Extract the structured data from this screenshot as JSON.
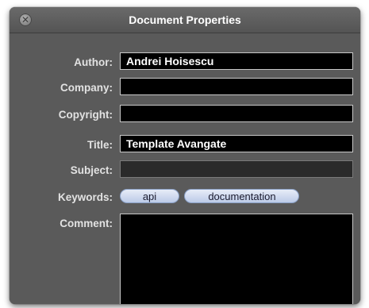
{
  "window": {
    "title": "Document Properties",
    "close_icon": "close-icon",
    "close_glyph": "✕"
  },
  "fields": {
    "author": {
      "label": "Author:",
      "value": "Andrei Hoisescu"
    },
    "company": {
      "label": "Company:",
      "value": ""
    },
    "copyright": {
      "label": "Copyright:",
      "value": ""
    },
    "title": {
      "label": "Title:",
      "value": "Template Avangate"
    },
    "subject": {
      "label": "Subject:",
      "value": ""
    },
    "keywords": {
      "label": "Keywords:",
      "tokens": [
        "api",
        "documentation"
      ]
    },
    "comment": {
      "label": "Comment:",
      "value": ""
    }
  },
  "colors": {
    "panel": "#5a5a5a",
    "field_bg": "#000000",
    "token_fill": "#c9d6ee"
  }
}
